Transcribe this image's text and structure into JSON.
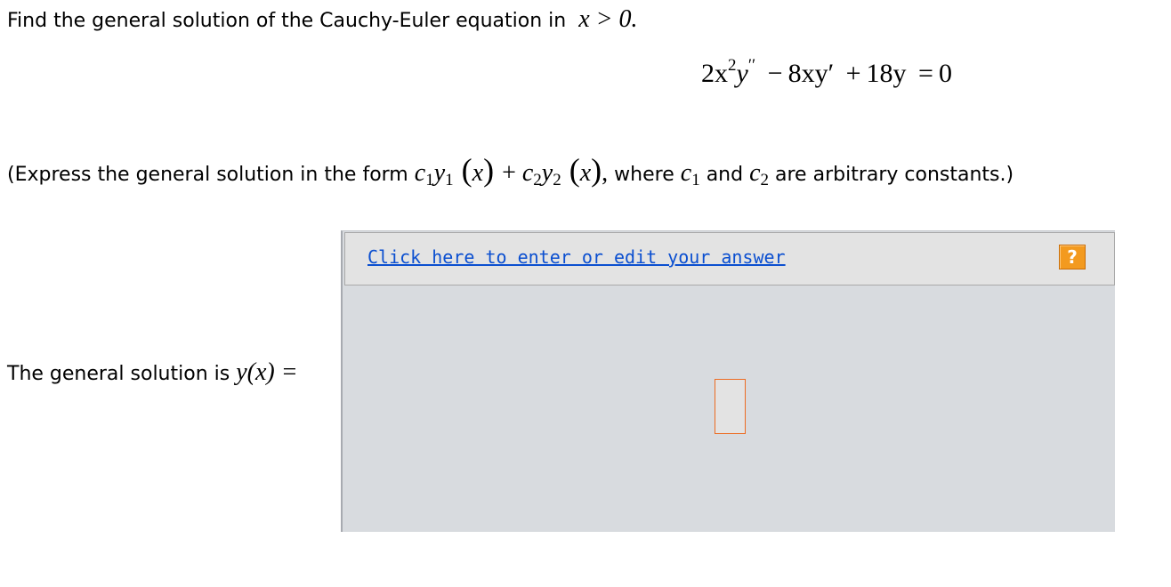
{
  "problem": {
    "prompt": "Find the general solution of the Cauchy-Euler equation in",
    "condition": "x > 0."
  },
  "equation": {
    "coef1": "2x",
    "exp1": "2",
    "term1_var": "y",
    "term1_primes": "′′",
    "op1": "−",
    "term2": "8xy′",
    "op2": "+",
    "term3": "18y",
    "op3": "=",
    "rhs": "0"
  },
  "instruction": {
    "prefix": "(Express the general solution in the form",
    "form": {
      "c1": "c",
      "c1_sub": "1",
      "y1": "y",
      "y1_sub": "1",
      "arg1": "x",
      "plus": "+",
      "c2": "c",
      "c2_sub": "2",
      "y2": "y",
      "y2_sub": "2",
      "arg2": "x",
      "comma": ","
    },
    "middle1": "where",
    "const1": "c",
    "const1_sub": "1",
    "middle2": "and",
    "const2": "c",
    "const2_sub": "2",
    "suffix": "are arbitrary constants.)"
  },
  "answer": {
    "label": "The general solution is",
    "lhs": "y(x) =",
    "edit_link": "Click here to enter or edit your answer",
    "help_label": "?",
    "help_icon": "question-mark-icon"
  }
}
